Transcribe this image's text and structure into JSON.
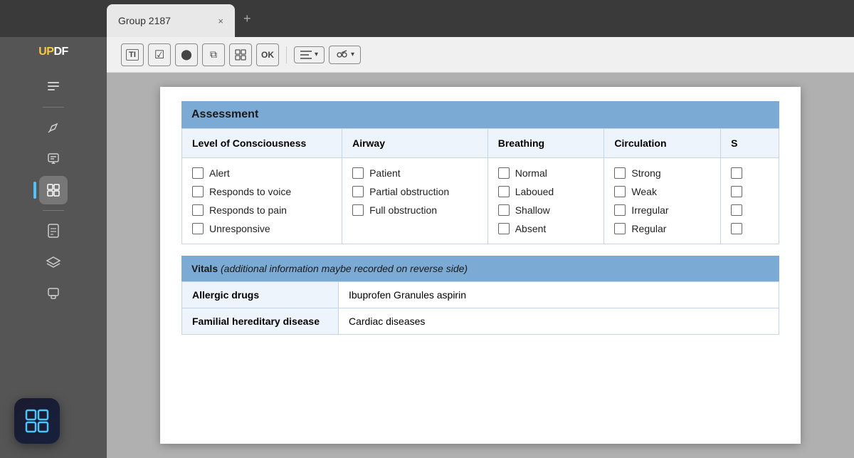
{
  "app": {
    "logo_up": "UP",
    "logo_df": "DF"
  },
  "titlebar": {
    "tab_title": "Group 2187",
    "close_icon": "×",
    "add_icon": "+"
  },
  "toolbar": {
    "buttons": [
      {
        "id": "text",
        "label": "TI",
        "type": "text-icon"
      },
      {
        "id": "checkbox",
        "label": "☑",
        "type": "icon"
      },
      {
        "id": "radio",
        "label": "⬤",
        "type": "icon"
      },
      {
        "id": "copy",
        "label": "⧉",
        "type": "icon"
      },
      {
        "id": "grid",
        "label": "⊞",
        "type": "icon"
      },
      {
        "id": "ok",
        "label": "OK",
        "type": "text"
      },
      {
        "id": "align",
        "label": "≡",
        "type": "icon"
      },
      {
        "id": "tools",
        "label": "⚒",
        "type": "icon"
      }
    ]
  },
  "sidebar": {
    "items": [
      {
        "id": "library",
        "icon": "≡",
        "active": false
      },
      {
        "id": "highlight",
        "icon": "✏",
        "active": false
      },
      {
        "id": "comment",
        "icon": "📝",
        "active": false
      },
      {
        "id": "grid-view",
        "icon": "⊞",
        "active": true
      },
      {
        "id": "page",
        "icon": "📄",
        "active": false
      },
      {
        "id": "layers",
        "icon": "⧉",
        "active": false
      },
      {
        "id": "copy2",
        "icon": "⊞",
        "active": false
      }
    ]
  },
  "document": {
    "assessment": {
      "header": "Assessment",
      "columns": [
        {
          "id": "loc",
          "header": "Level of Consciousness",
          "items": [
            "Alert",
            "Responds to voice",
            "Responds to pain",
            "Unresponsive"
          ]
        },
        {
          "id": "airway",
          "header": "Airway",
          "items": [
            "Patient",
            "Partial obstruction",
            "Full obstruction"
          ]
        },
        {
          "id": "breathing",
          "header": "Breathing",
          "items": [
            "Normal",
            "Laboued",
            "Shallow",
            "Absent"
          ]
        },
        {
          "id": "circulation",
          "header": "Circulation",
          "items": [
            "Strong",
            "Weak",
            "Irregular",
            "Regular"
          ]
        },
        {
          "id": "s",
          "header": "S",
          "items": []
        }
      ]
    },
    "vitals": {
      "header_bold": "Vitals",
      "header_italic": "  (additional information maybe recorded on reverse side)",
      "rows": [
        {
          "label": "Allergic drugs",
          "value": "Ibuprofen Granules  aspirin"
        },
        {
          "label": "Familial hereditary disease",
          "value": "Cardiac diseases"
        }
      ]
    }
  }
}
